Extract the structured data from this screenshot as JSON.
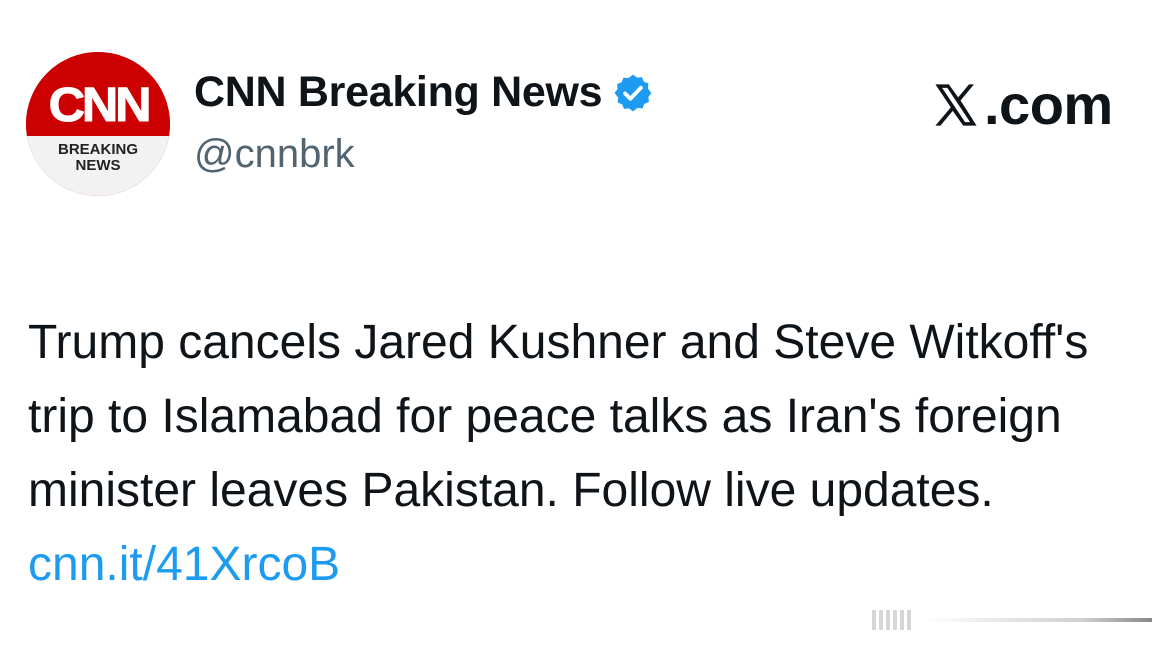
{
  "profile": {
    "avatar_logo": "CNN",
    "avatar_caption_line1": "BREAKING",
    "avatar_caption_line2": "NEWS",
    "display_name": "CNN Breaking News",
    "handle": "@cnnbrk",
    "verified": true
  },
  "site": {
    "label": ".com",
    "icon": "x-logo-icon"
  },
  "post": {
    "text": "Trump cancels Jared Kushner and Steve Witkoff's trip to Islamabad for peace talks as Iran's foreign minister leaves Pakistan. Follow live updates. ",
    "link_text": "cnn.it/41XrcoB"
  },
  "colors": {
    "brand_red": "#cc0000",
    "link_blue": "#1d9bf0",
    "verified_blue": "#1d9bf0",
    "handle_gray": "#536471"
  }
}
